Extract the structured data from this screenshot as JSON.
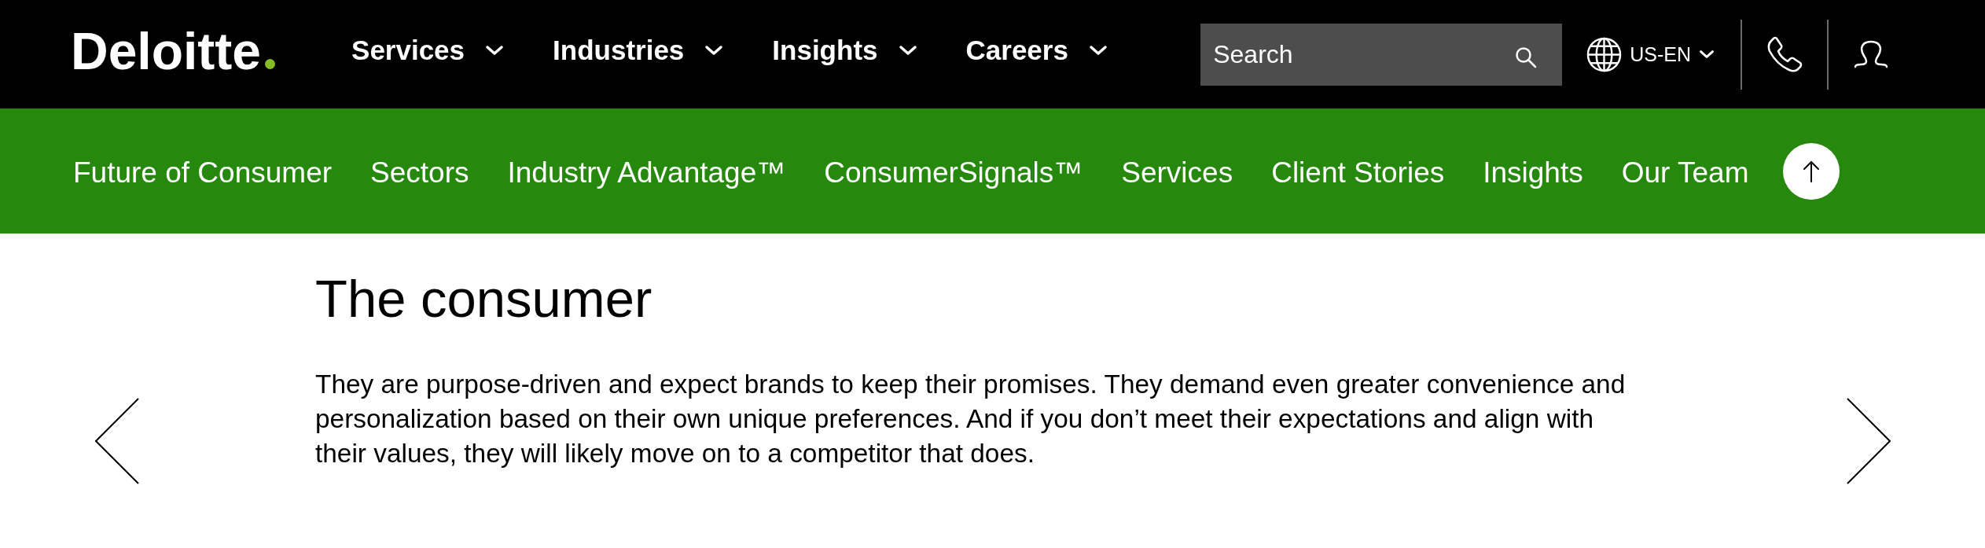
{
  "header": {
    "logo": "Deloitte",
    "nav": [
      {
        "label": "Services",
        "expanded": false
      },
      {
        "label": "Industries",
        "expanded": false
      },
      {
        "label": "Insights",
        "expanded": false
      },
      {
        "label": "Careers",
        "expanded": false
      }
    ],
    "search": {
      "placeholder": "Search"
    },
    "locale": {
      "label": "US-EN",
      "expanded": false
    }
  },
  "subnav": {
    "items": [
      "Future of Consumer",
      "Sectors",
      "Industry Advantage™",
      "ConsumerSignals™",
      "Services",
      "Client Stories",
      "Insights",
      "Our Team"
    ]
  },
  "slide": {
    "title": "The consumer",
    "body": "They are purpose-driven and expect brands to keep their promises. They demand even greater convenience and personalization based on their own unique preferences. And if you don’t meet their expectations and align with their values, they will likely move on to a competitor that does."
  }
}
